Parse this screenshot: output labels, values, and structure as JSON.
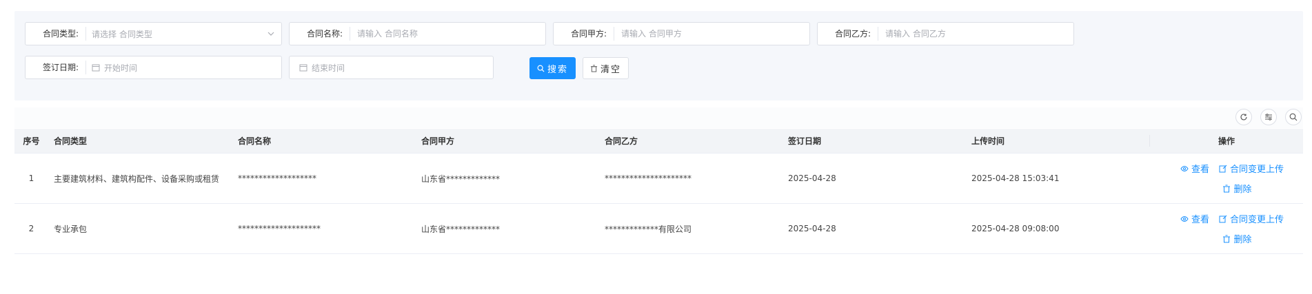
{
  "search": {
    "contract_type": {
      "label": "合同类型:",
      "placeholder": "请选择 合同类型"
    },
    "contract_name": {
      "label": "合同名称:",
      "placeholder": "请输入 合同名称"
    },
    "party_a": {
      "label": "合同甲方:",
      "placeholder": "请输入 合同甲方"
    },
    "party_b": {
      "label": "合同乙方:",
      "placeholder": "请输入 合同乙方"
    },
    "sign_date": {
      "label": "签订日期:",
      "start_placeholder": "开始时间",
      "end_placeholder": "结束时间"
    },
    "search_button": "搜索",
    "clear_button": "清空"
  },
  "toolbar": {
    "icons": [
      "refresh-icon",
      "column-settings-icon",
      "search-toggle-icon"
    ]
  },
  "table": {
    "headers": {
      "index": "序号",
      "type": "合同类型",
      "name": "合同名称",
      "party_a": "合同甲方",
      "party_b": "合同乙方",
      "sign_date": "签订日期",
      "upload_time": "上传时间",
      "ops": "操作"
    },
    "rows": [
      {
        "index": "1",
        "type": "主要建筑材料、建筑构配件、设备采购或租赁",
        "name": "*******************",
        "party_a": "山东省*************",
        "party_b": "*********************",
        "sign_date": "2025-04-28",
        "upload_time": "2025-04-28 15:03:41"
      },
      {
        "index": "2",
        "type": "专业承包",
        "name": "********************",
        "party_a": "山东省*************",
        "party_b": "*************有限公司",
        "sign_date": "2025-04-28",
        "upload_time": "2025-04-28 09:08:00"
      }
    ],
    "ops": {
      "view": "查看",
      "change_upload": "合同变更上传",
      "delete": "删除"
    }
  },
  "colors": {
    "primary": "#1890ff",
    "panel_bg": "#f5f7fb",
    "header_bg": "#f2f4f7"
  }
}
